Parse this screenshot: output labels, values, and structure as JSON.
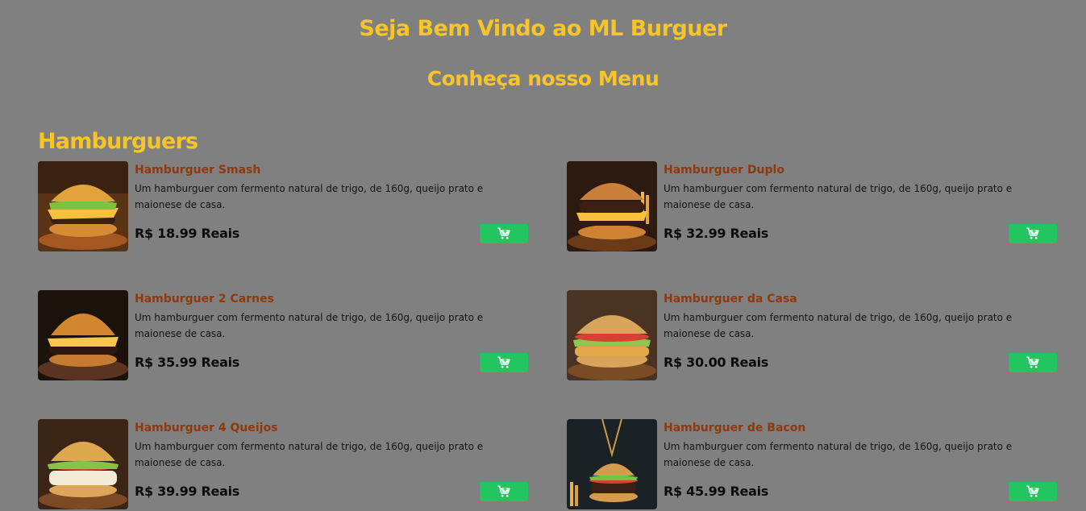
{
  "header": {
    "welcome": "Seja Bem Vindo ao ML Burguer",
    "menu_title": "Conheça nosso Menu"
  },
  "section": {
    "title": "Hamburguers"
  },
  "items": [
    {
      "name": "Hamburguer Smash",
      "description": "Um hamburguer com fermento natural de trigo, de 160g, queijo prato e maionese de casa.",
      "price": "R$ 18.99 Reais",
      "image": "burger-smash-image"
    },
    {
      "name": "Hamburguer Duplo",
      "description": "Um hamburguer com fermento natural de trigo, de 160g, queijo prato e maionese de casa.",
      "price": "R$ 32.99 Reais",
      "image": "burger-duplo-image"
    },
    {
      "name": "Hamburguer 2 Carnes",
      "description": "Um hamburguer com fermento natural de trigo, de 160g, queijo prato e maionese de casa.",
      "price": "R$ 35.99 Reais",
      "image": "burger-2-carnes-image"
    },
    {
      "name": "Hamburguer da Casa",
      "description": "Um hamburguer com fermento natural de trigo, de 160g, queijo prato e maionese de casa.",
      "price": "R$ 30.00 Reais",
      "image": "burger-da-casa-image"
    },
    {
      "name": "Hamburguer 4 Queijos",
      "description": "Um hamburguer com fermento natural de trigo, de 160g, queijo prato e maionese de casa.",
      "price": "R$ 39.99 Reais",
      "image": "burger-4-queijos-image"
    },
    {
      "name": "Hamburguer de Bacon",
      "description": "Um hamburguer com fermento natural de trigo, de 160g, queijo prato e maionese de casa.",
      "price": "R$ 45.99 Reais",
      "image": "burger-bacon-image"
    }
  ],
  "cart_button": {
    "icon": "add-to-cart-icon"
  },
  "colors": {
    "background": "#808080",
    "heading": "#f7c52a",
    "item_name": "#8a3a10",
    "cart_button": "#22c55e"
  }
}
